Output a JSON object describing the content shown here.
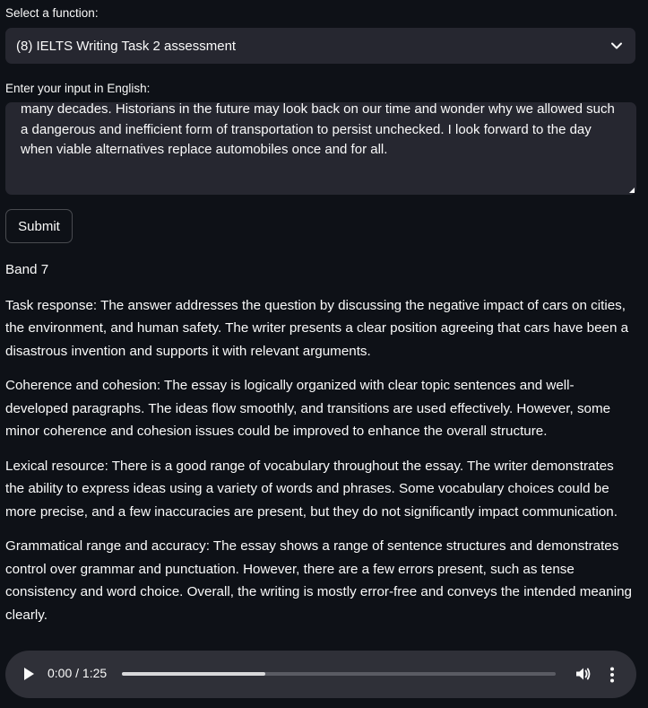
{
  "function_select": {
    "label": "Select a function:",
    "selected": "(8) IELTS Writing Task 2 assessment"
  },
  "input": {
    "label": "Enter your input in English:",
    "value": "many decades. Historians in the future may look back on our time and wonder why we allowed such a dangerous and inefficient form of transportation to persist unchecked. I look forward to the day when viable alternatives replace automobiles once and for all."
  },
  "submit": {
    "label": "Submit"
  },
  "result": {
    "band": "Band 7",
    "paragraphs": [
      "Task response: The answer addresses the question by discussing the negative impact of cars on cities, the environment, and human safety. The writer presents a clear position agreeing that cars have been a disastrous invention and supports it with relevant arguments.",
      "Coherence and cohesion: The essay is logically organized with clear topic sentences and well-developed paragraphs. The ideas flow smoothly, and transitions are used effectively. However, some minor coherence and cohesion issues could be improved to enhance the overall structure.",
      "Lexical resource: There is a good range of vocabulary throughout the essay. The writer demonstrates the ability to express ideas using a variety of words and phrases. Some vocabulary choices could be more precise, and a few inaccuracies are present, but they do not significantly impact communication.",
      "Grammatical range and accuracy: The essay shows a range of sentence structures and demonstrates control over grammar and punctuation. However, there are a few errors present, such as tense consistency and word choice. Overall, the writing is mostly error-free and conveys the intended meaning clearly."
    ]
  },
  "audio": {
    "time": "0:00 / 1:25",
    "buffered_fraction": 0.33,
    "icons": [
      "play-icon",
      "volume-icon",
      "more-options-icon"
    ]
  },
  "colors": {
    "background": "#0e1117",
    "input_background": "#262730",
    "audio_background": "#2f3038",
    "text": "#fafafa"
  }
}
